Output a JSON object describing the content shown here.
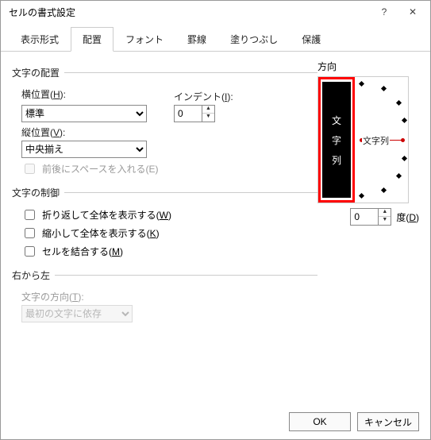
{
  "title": "セルの書式設定",
  "tabs": [
    "表示形式",
    "配置",
    "フォント",
    "罫線",
    "塗りつぶし",
    "保護"
  ],
  "active_tab_index": 1,
  "alignment": {
    "group_label": "文字の配置",
    "horizontal_label_prefix": "横位置(",
    "horizontal_label_u": "H",
    "horizontal_label_suffix": "):",
    "horizontal_value": "標準",
    "indent_label_prefix": "インデント(",
    "indent_label_u": "I",
    "indent_label_suffix": "):",
    "indent_value": "0",
    "vertical_label_prefix": "縦位置(",
    "vertical_label_u": "V",
    "vertical_label_suffix": "):",
    "vertical_value": "中央揃え",
    "space_label": "前後にスペースを入れる(E)"
  },
  "control": {
    "group_label": "文字の制御",
    "wrap_prefix": "折り返して全体を表示する(",
    "wrap_u": "W",
    "wrap_suffix": ")",
    "shrink_prefix": "縮小して全体を表示する(",
    "shrink_u": "K",
    "shrink_suffix": ")",
    "merge_prefix": "セルを結合する(",
    "merge_u": "M",
    "merge_suffix": ")"
  },
  "rtl": {
    "group_label": "右から左",
    "dir_label_prefix": "文字の方向(",
    "dir_label_u": "T",
    "dir_label_suffix": "):",
    "dir_value": "最初の文字に依存"
  },
  "orientation": {
    "label": "方向",
    "stack_char1": "文",
    "stack_char2": "字",
    "stack_char3": "列",
    "dial_label": "文字列",
    "degree_value": "0",
    "degree_unit_prefix": "度(",
    "degree_unit_u": "D",
    "degree_unit_suffix": ")"
  },
  "buttons": {
    "ok": "OK",
    "cancel": "キャンセル"
  }
}
